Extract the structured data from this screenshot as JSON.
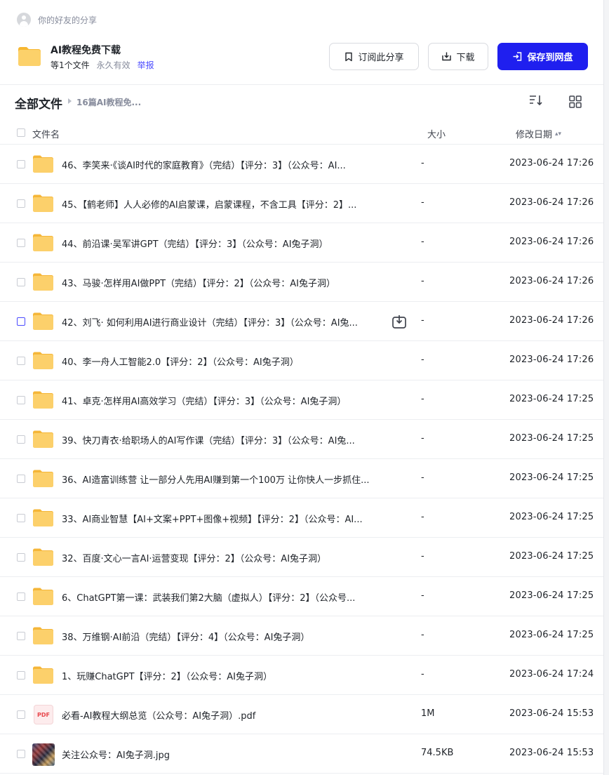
{
  "sharer": {
    "text": "你的好友的分享",
    "avatar_icon": "user-avatar-icon"
  },
  "share": {
    "title": "AI教程免费下载",
    "file_count": "等1个文件",
    "validity": "永久有效",
    "report": "举报",
    "icon": "folder-icon"
  },
  "buttons": {
    "subscribe": "订阅此分享",
    "download": "下载",
    "save": "保存到网盘"
  },
  "breadcrumb": {
    "root": "全部文件",
    "current": "16篇AI教程免..."
  },
  "columns": {
    "name": "文件名",
    "size": "大小",
    "date": "修改日期"
  },
  "colors": {
    "primary": "#1f1fef",
    "link": "#4b4bff",
    "folder": "#fbc956",
    "pdf": "#e8474c"
  },
  "files": [
    {
      "type": "folder",
      "name": "46、李笑来·《谈AI时代的家庭教育》（完结）【评分：3】（公众号：AI...",
      "size": "-",
      "date": "2023-06-24 17:26"
    },
    {
      "type": "folder",
      "name": "45、【鹤老师】人人必修的AI启蒙课，启蒙课程，不含工具【评分：2】...",
      "size": "-",
      "date": "2023-06-24 17:26"
    },
    {
      "type": "folder",
      "name": "44、前沿课·吴军讲GPT（完结）【评分：3】（公众号：AI兔子洞）",
      "size": "-",
      "date": "2023-06-24 17:26"
    },
    {
      "type": "folder",
      "name": "43、马骏·怎样用AI做PPT（完结）【评分：2】（公众号：AI兔子洞）",
      "size": "-",
      "date": "2023-06-24 17:26"
    },
    {
      "type": "folder",
      "name": "42、刘飞· 如何利用AI进行商业设计（完结）【评分：3】（公众号：AI兔...",
      "size": "-",
      "date": "2023-06-24 17:26",
      "hover": true
    },
    {
      "type": "folder",
      "name": "40、李一舟人工智能2.0【评分：2】（公众号：AI兔子洞）",
      "size": "-",
      "date": "2023-06-24 17:26"
    },
    {
      "type": "folder",
      "name": "41、卓克·怎样用AI高效学习（完结）【评分：3】（公众号：AI兔子洞）",
      "size": "-",
      "date": "2023-06-24 17:25"
    },
    {
      "type": "folder",
      "name": "39、快刀青衣·给职场人的AI写作课（完结）【评分：3】（公众号：AI兔...",
      "size": "-",
      "date": "2023-06-24 17:25"
    },
    {
      "type": "folder",
      "name": "36、AI造富训练营 让一部分人先用AI赚到第一个100万 让你快人一步抓住...",
      "size": "-",
      "date": "2023-06-24 17:25"
    },
    {
      "type": "folder",
      "name": "33、AI商业智慧【AI+文案+PPT+图像+视频】【评分：2】（公众号：AI...",
      "size": "-",
      "date": "2023-06-24 17:25"
    },
    {
      "type": "folder",
      "name": "32、百度·文心一言AI·运营变现【评分：2】（公众号：AI兔子洞）",
      "size": "-",
      "date": "2023-06-24 17:25"
    },
    {
      "type": "folder",
      "name": "6、ChatGPT第一课：武装我们第2大脑（虚拟人）【评分：2】（公众号...",
      "size": "-",
      "date": "2023-06-24 17:25"
    },
    {
      "type": "folder",
      "name": "38、万维钢·AI前沿（完结）【评分：4】（公众号：AI兔子洞）",
      "size": "-",
      "date": "2023-06-24 17:25"
    },
    {
      "type": "folder",
      "name": "1、玩赚ChatGPT【评分：2】（公众号：AI兔子洞）",
      "size": "-",
      "date": "2023-06-24 17:24"
    },
    {
      "type": "pdf",
      "name": "必看-AI教程大纲总览（公众号：AI兔子洞）.pdf",
      "size": "1M",
      "date": "2023-06-24 15:53",
      "badge": "PDF"
    },
    {
      "type": "jpg",
      "name": "关注公众号：AI兔子洞.jpg",
      "size": "74.5KB",
      "date": "2023-06-24 15:53"
    }
  ]
}
